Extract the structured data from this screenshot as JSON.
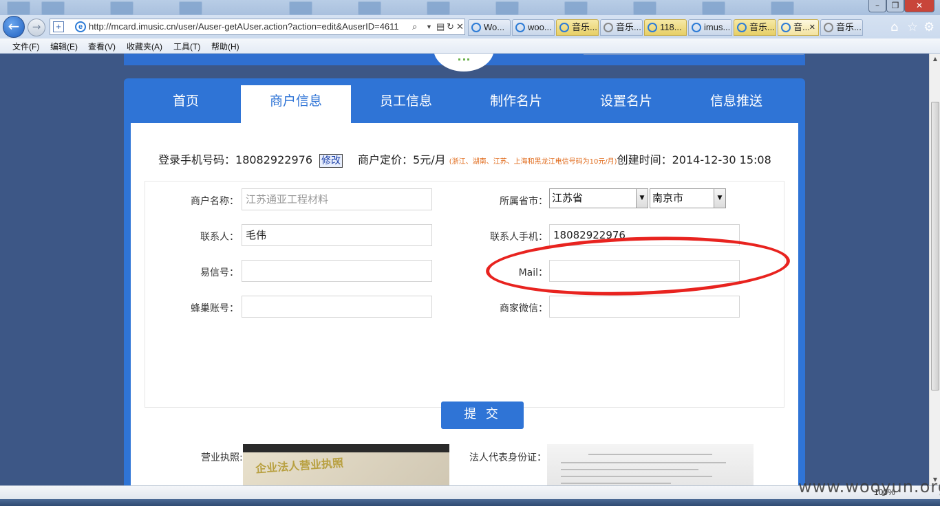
{
  "browser": {
    "url": "http://mcard.imusic.cn/user/Auser-getAUser.action?action=edit&AuserID=4611",
    "tabs": [
      "Wo...",
      "woo...",
      "音乐...",
      "音乐...",
      "118...",
      "imus...",
      "音乐...",
      "音...",
      "音乐..."
    ],
    "menu": [
      "文件(F)",
      "编辑(E)",
      "查看(V)",
      "收藏夹(A)",
      "工具(T)",
      "帮助(H)"
    ],
    "zoom": "100%"
  },
  "nav": {
    "tabs": [
      "首页",
      "商户信息",
      "员工信息",
      "制作名片",
      "设置名片",
      "信息推送"
    ],
    "active": "商户信息"
  },
  "info": {
    "phone_label": "登录手机号码：",
    "phone": "18082922976",
    "edit_label": "修改",
    "price_label": "商户定价：",
    "price": "5元/月",
    "price_note": "(浙江、湖南、江苏、上海和黑龙江电信号码为10元/月)",
    "created_label": "创建时间：",
    "created": "2014-12-30 15:08"
  },
  "form": {
    "merchant_name_label": "商户名称：",
    "merchant_name": "江苏通亚工程材料",
    "contact_label": "联系人：",
    "contact": "毛伟",
    "yixin_label": "易信号：",
    "yixin": "",
    "fengchao_label": "蜂巢账号：",
    "fengchao": "",
    "province_label": "所属省市：",
    "province": "江苏省",
    "city": "南京市",
    "contact_phone_label": "联系人手机：",
    "contact_phone": "18082922976",
    "mail_label": "Mail：",
    "mail": "",
    "wechat_label": "商家微信：",
    "wechat": "",
    "submit_label": "提 交"
  },
  "images": {
    "license_label": "营业执照:",
    "license_text": "企业法人营业执照",
    "legal_id_label": "法人代表身份证："
  },
  "watermark": "www.wooyun.org"
}
